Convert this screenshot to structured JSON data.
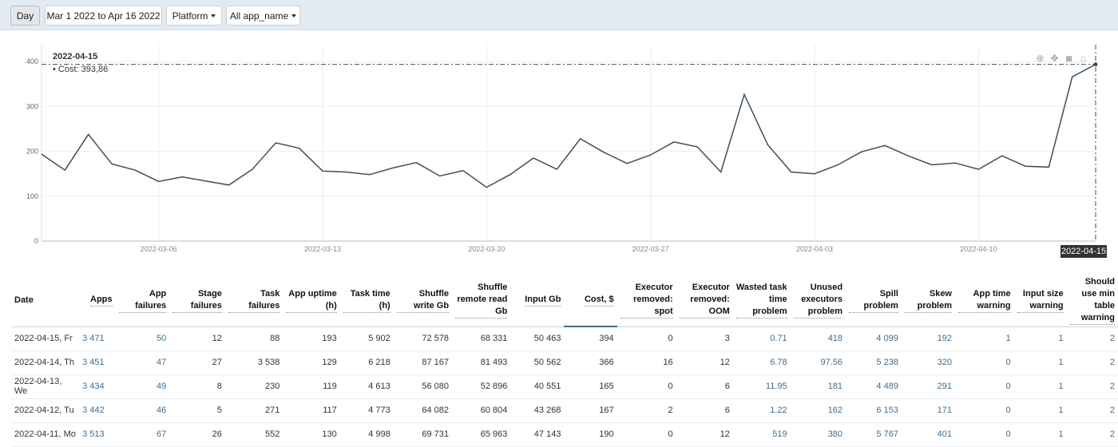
{
  "toolbar": {
    "granularity": "Day",
    "date_range": "Mar 1 2022 to Apr 16 2022",
    "platform": "Platform",
    "app_filter": "All app_name"
  },
  "chart": {
    "tooltip_date": "2022-04-15",
    "tooltip_value": "• Cost: 393,86",
    "hover_x_label": "2022-04-15",
    "line_color": "#3c4e5e"
  },
  "chart_data": {
    "type": "line",
    "x": [
      "2022-03-01",
      "2022-03-02",
      "2022-03-03",
      "2022-03-04",
      "2022-03-05",
      "2022-03-06",
      "2022-03-07",
      "2022-03-08",
      "2022-03-09",
      "2022-03-10",
      "2022-03-11",
      "2022-03-12",
      "2022-03-13",
      "2022-03-14",
      "2022-03-15",
      "2022-03-16",
      "2022-03-17",
      "2022-03-18",
      "2022-03-19",
      "2022-03-20",
      "2022-03-21",
      "2022-03-22",
      "2022-03-23",
      "2022-03-24",
      "2022-03-25",
      "2022-03-26",
      "2022-03-27",
      "2022-03-28",
      "2022-03-29",
      "2022-03-30",
      "2022-03-31",
      "2022-04-01",
      "2022-04-02",
      "2022-04-03",
      "2022-04-04",
      "2022-04-05",
      "2022-04-06",
      "2022-04-07",
      "2022-04-08",
      "2022-04-09",
      "2022-04-10",
      "2022-04-11",
      "2022-04-12",
      "2022-04-13",
      "2022-04-14",
      "2022-04-15"
    ],
    "series": [
      {
        "values": [
          194,
          158,
          238,
          172,
          158,
          133,
          143,
          134,
          125,
          160,
          219,
          207,
          156,
          154,
          148,
          163,
          175,
          145,
          157,
          120,
          148,
          185,
          160,
          228,
          198,
          173,
          192,
          221,
          210,
          154,
          327,
          215,
          154,
          150,
          170,
          199,
          213,
          190,
          170,
          174,
          160,
          190,
          167,
          165,
          366,
          394
        ]
      }
    ],
    "x_ticks": [
      "2022-03-06",
      "2022-03-13",
      "2022-03-20",
      "2022-03-27",
      "2022-04-03",
      "2022-04-10"
    ],
    "y_ticks": [
      0,
      100,
      200,
      300,
      400
    ],
    "ylim": [
      0,
      420
    ],
    "grid": true
  },
  "table": {
    "columns": [
      "Date",
      "Apps",
      "App failures",
      "Stage failures",
      "Task failures",
      "App uptime (h)",
      "Task time (h)",
      "Shuffle write Gb",
      "Shuffle remote read Gb",
      "Input Gb",
      "Cost, $",
      "Executor removed: spot",
      "Executor removed: OOM",
      "Wasted task time problem",
      "Unused executors problem",
      "Spill problem",
      "Skew problem",
      "App time warning",
      "Input size warning",
      "Should use min table warning"
    ],
    "rows": [
      [
        "2022-04-15, Fr",
        "3 471",
        "50",
        "12",
        "88",
        "193",
        "5 902",
        "72 578",
        "68 331",
        "50 463",
        "394",
        "0",
        "3",
        "0.71",
        "418",
        "4 099",
        "192",
        "1",
        "1",
        "2"
      ],
      [
        "2022-04-14, Th",
        "3 451",
        "47",
        "27",
        "3 538",
        "129",
        "6 218",
        "87 167",
        "81 493",
        "50 562",
        "366",
        "16",
        "12",
        "6.78",
        "97.56",
        "5 238",
        "320",
        "0",
        "1",
        "2"
      ],
      [
        "2022-04-13, We",
        "3 434",
        "49",
        "8",
        "230",
        "119",
        "4 613",
        "56 080",
        "52 896",
        "40 551",
        "165",
        "0",
        "6",
        "11.95",
        "181",
        "4 489",
        "291",
        "0",
        "1",
        "2"
      ],
      [
        "2022-04-12, Tu",
        "3 442",
        "46",
        "5",
        "271",
        "117",
        "4 773",
        "64 082",
        "60 804",
        "43 268",
        "167",
        "2",
        "6",
        "1.22",
        "162",
        "6 153",
        "171",
        "0",
        "1",
        "2"
      ],
      [
        "2022-04-11, Mo",
        "3 513",
        "67",
        "26",
        "552",
        "130",
        "4 998",
        "69 731",
        "65 963",
        "47 143",
        "190",
        "0",
        "12",
        "519",
        "380",
        "5 767",
        "401",
        "0",
        "1",
        "2"
      ]
    ]
  }
}
